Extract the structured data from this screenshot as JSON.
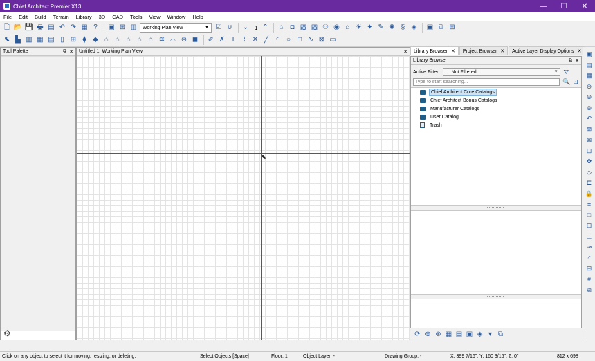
{
  "window": {
    "title": "Chief Architect Premier X13",
    "controls": [
      "—",
      "☐",
      "✕"
    ]
  },
  "menu": [
    "File",
    "Edit",
    "Build",
    "Terrain",
    "Library",
    "3D",
    "CAD",
    "Tools",
    "View",
    "Window",
    "Help"
  ],
  "toolbar1": {
    "view_dropdown": "Working Plan View",
    "floor_number": "1"
  },
  "tool_palette": {
    "title": "Tool Palette"
  },
  "plan_view": {
    "title": "Untitled 1:  Working Plan View"
  },
  "tabs": [
    {
      "label": "Library Browser"
    },
    {
      "label": "Project Browser"
    },
    {
      "label": "Active Layer Display Options"
    }
  ],
  "library": {
    "title": "Library Browser",
    "filter_label": "Active Filter:",
    "filter_value": "Not Filtered",
    "search_placeholder": "Type to start searching...",
    "items": [
      {
        "label": "Chief Architect Core Catalogs"
      },
      {
        "label": "Chief Architect Bonus Catalogs"
      },
      {
        "label": "Manufacturer Catalogs"
      },
      {
        "label": "User Catalog"
      },
      {
        "label": "Trash"
      }
    ]
  },
  "status": {
    "hint": "Click on any object to select it for moving, resizing, or deleting.",
    "mode": "Select Objects [Space]",
    "floor": "Floor: 1",
    "layer": "Object Layer: -",
    "group": "Drawing Group: -",
    "coords": "X: 399 7/16\", Y: 160 3/16\", Z: 0\"",
    "size": "812 x 698"
  },
  "colors": {
    "titlebar": "#6a2a9f",
    "axis": "#3d52c8",
    "selection": "#cde4f7",
    "folder": "#1f5e86"
  }
}
